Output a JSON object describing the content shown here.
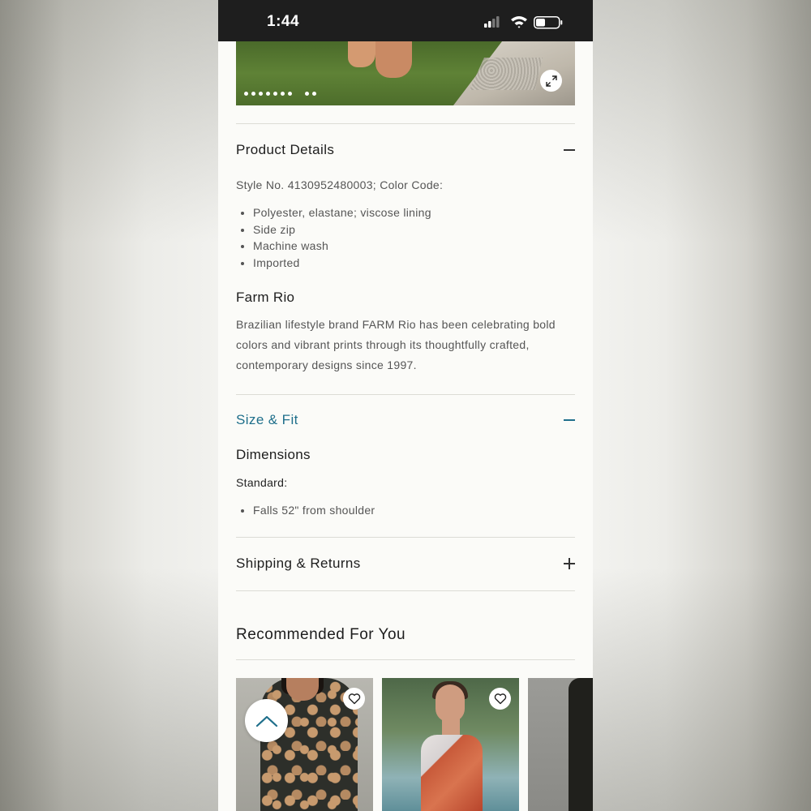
{
  "status_bar": {
    "time": "1:44",
    "icons": [
      "cellular-signal-icon",
      "wifi-icon",
      "battery-icon"
    ]
  },
  "hero": {
    "carousel_dot_count": 10,
    "expand_icon": "expand-icon"
  },
  "product_details": {
    "title": "Product Details",
    "toggle_icon": "minus-icon",
    "style_line": "Style No. 4130952480003; Color Code:",
    "bullets": [
      "Polyester, elastane; viscose lining",
      "Side zip",
      "Machine wash",
      "Imported"
    ],
    "brand": {
      "name": "Farm Rio",
      "description": "Brazilian lifestyle brand FARM Rio has been celebrating bold colors and vibrant prints through its thoughtfully crafted, contemporary designs since 1997."
    }
  },
  "size_fit": {
    "title": "Size & Fit",
    "toggle_icon": "minus-icon",
    "dimensions_heading": "Dimensions",
    "standard_label": "Standard:",
    "bullets": [
      "Falls 52\" from shoulder"
    ]
  },
  "shipping": {
    "title": "Shipping & Returns",
    "toggle_icon": "plus-icon"
  },
  "recommended": {
    "title": "Recommended For You",
    "card_icon": "heart-icon",
    "scroll_icon": "chevron-up-icon"
  },
  "colors": {
    "accent": "#1f6f8b",
    "text": "#1d1d1d",
    "muted_text": "#555555",
    "divider": "#dcdcd6",
    "background": "#fbfbf8"
  }
}
